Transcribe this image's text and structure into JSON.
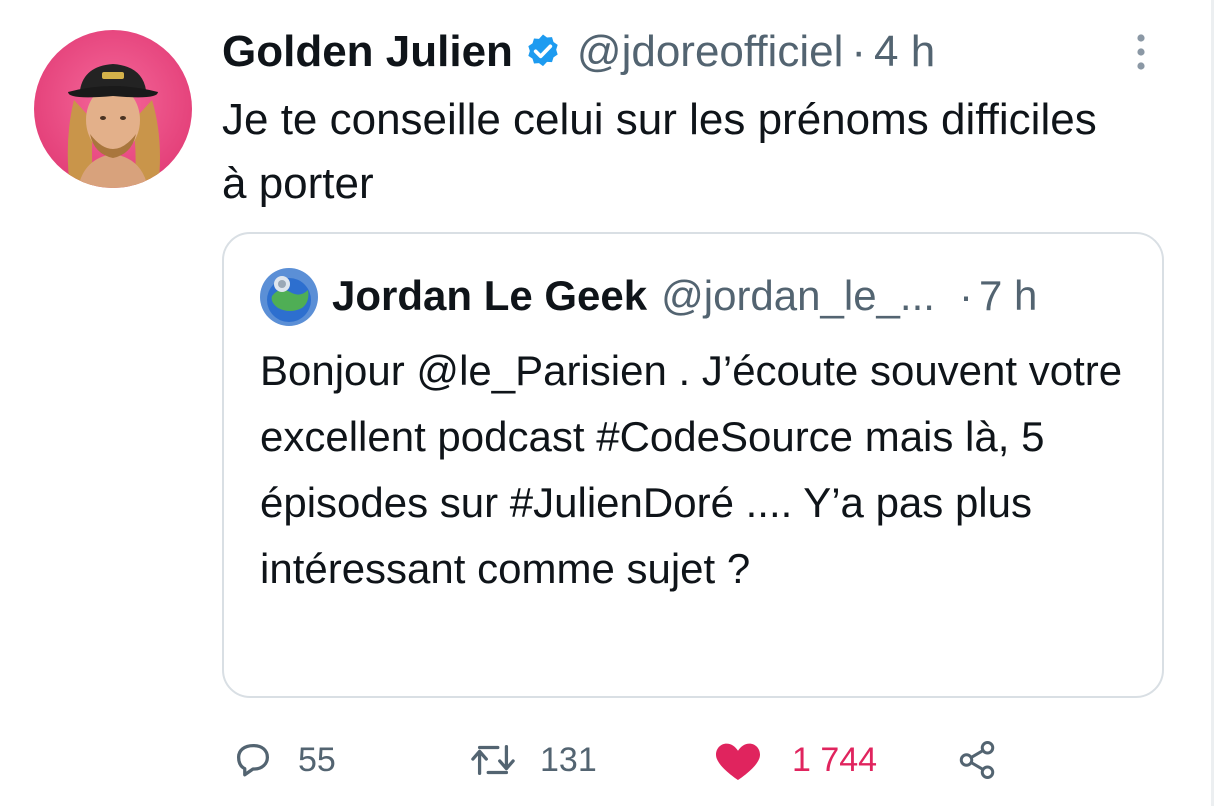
{
  "tweet": {
    "author": {
      "name": "Golden Julien",
      "handle": "@jdoreofficiel",
      "time": "4 h",
      "verified": true,
      "avatar": "profile-avatar-hat-long-hair"
    },
    "text": "Je te conseille celui sur les prénoms difficiles à porter",
    "quoted": {
      "author": {
        "name": "Jordan Le Geek",
        "handle": "@jordan_le_...",
        "time": "7 h",
        "avatar": "profile-avatar-globe"
      },
      "text": "Bonjour @le_Parisien . J’écoute souvent votre excellent podcast #CodeSource mais là, 5 épisodes sur #JulienDoré .... Y’a pas plus intéressant comme sujet ?"
    },
    "actions": {
      "reply": {
        "icon": "speech-bubble-icon",
        "count": "55"
      },
      "retweet": {
        "icon": "retweet-arrows-icon",
        "count": "131"
      },
      "like": {
        "icon": "heart-icon",
        "count": "1 744",
        "liked": true
      },
      "share": {
        "icon": "share-nodes-icon"
      }
    }
  },
  "colors": {
    "text": "#0f1419",
    "muted": "#536471",
    "verified": "#1d9bf0",
    "like": "#e0245e",
    "border": "#d9dfe4",
    "avatar_bg": "#e8417a"
  }
}
